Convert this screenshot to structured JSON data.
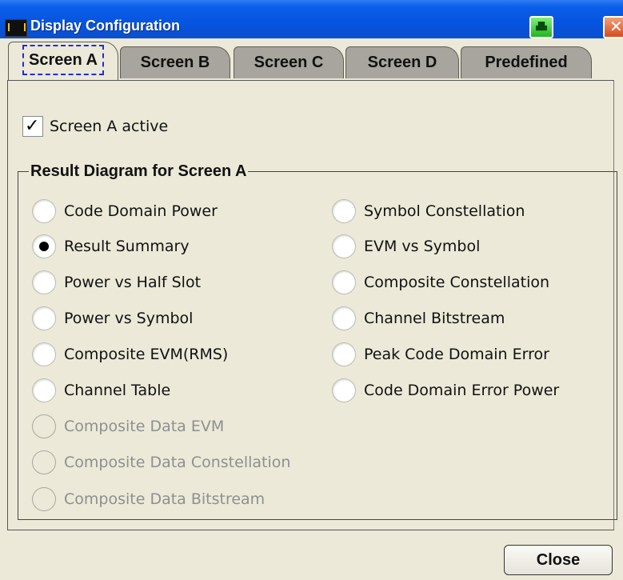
{
  "window": {
    "title": "Display Configuration"
  },
  "tabs": [
    {
      "label": "Screen A",
      "active": true
    },
    {
      "label": "Screen B",
      "active": false
    },
    {
      "label": "Screen C",
      "active": false
    },
    {
      "label": "Screen D",
      "active": false
    },
    {
      "label": "Predefined",
      "active": false
    }
  ],
  "screen_active": {
    "label": "Screen A active",
    "checked": true
  },
  "result_diagram": {
    "title": "Result Diagram for Screen A",
    "selected": "Result Summary",
    "left_options": [
      {
        "label": "Code Domain Power",
        "enabled": true
      },
      {
        "label": "Result Summary",
        "enabled": true
      },
      {
        "label": "Power vs Half Slot",
        "enabled": true
      },
      {
        "label": "Power vs Symbol",
        "enabled": true
      },
      {
        "label": "Composite EVM(RMS)",
        "enabled": true
      },
      {
        "label": "Channel Table",
        "enabled": true
      },
      {
        "label": "Composite Data EVM",
        "enabled": false
      },
      {
        "label": "Composite Data Constellation",
        "enabled": false
      },
      {
        "label": "Composite Data Bitstream",
        "enabled": false
      }
    ],
    "right_options": [
      {
        "label": "Symbol Constellation",
        "enabled": true
      },
      {
        "label": "EVM vs Symbol",
        "enabled": true
      },
      {
        "label": "Composite Constellation",
        "enabled": true
      },
      {
        "label": "Channel Bitstream",
        "enabled": true
      },
      {
        "label": "Peak Code Domain Error",
        "enabled": true
      },
      {
        "label": "Code Domain Error Power",
        "enabled": true
      }
    ]
  },
  "buttons": {
    "close_label": "Close"
  },
  "icons": {
    "app": "app-icon",
    "print": "printer-icon",
    "close": "close-icon"
  }
}
